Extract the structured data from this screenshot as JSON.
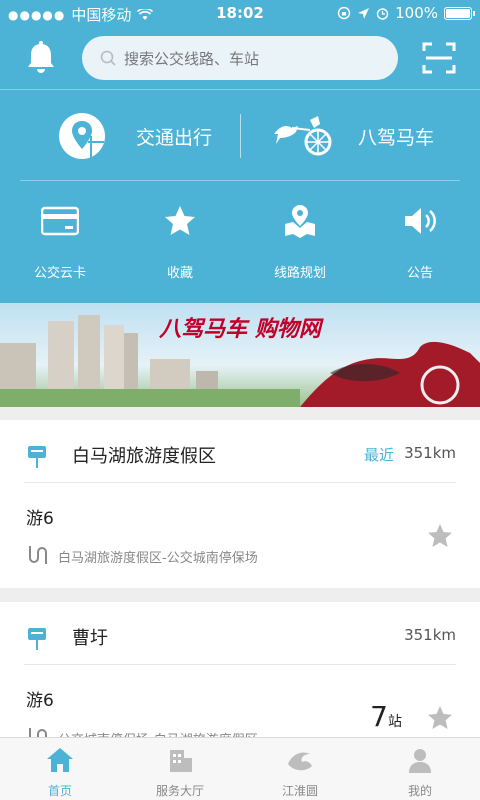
{
  "status": {
    "carrier": "中国移动",
    "time": "18:02",
    "battery": "100%"
  },
  "search": {
    "placeholder": "搜索公交线路、车站"
  },
  "features": [
    {
      "label": "交通出行",
      "icon": "map-pin-icon"
    },
    {
      "label": "八驾马车",
      "icon": "chariot-icon"
    }
  ],
  "quick": [
    {
      "label": "公交云卡",
      "icon": "card-icon"
    },
    {
      "label": "收藏",
      "icon": "star-icon"
    },
    {
      "label": "线路规划",
      "icon": "route-map-icon"
    },
    {
      "label": "公告",
      "icon": "speaker-icon"
    }
  ],
  "banner": {
    "text": "八驾马车 购物网"
  },
  "stations": [
    {
      "name": "白马湖旅游度假区",
      "recent": "最近",
      "distance": "351km",
      "line": "游6",
      "route": "白马湖旅游度假区-公交城南停保场",
      "stops_count": ""
    },
    {
      "name": "曹圩",
      "recent": "",
      "distance": "351km",
      "line": "游6",
      "route": "公交城南停保场-白马湖旅游度假区",
      "stops_count": "7",
      "stops_unit": "站"
    }
  ],
  "tabs": [
    {
      "label": "首页",
      "icon": "home-icon",
      "active": true
    },
    {
      "label": "服务大厅",
      "icon": "building-icon",
      "active": false
    },
    {
      "label": "江淮圆",
      "icon": "wave-icon",
      "active": false
    },
    {
      "label": "我的",
      "icon": "user-icon",
      "active": false
    }
  ],
  "colors": {
    "accent": "#4db3d6",
    "header": "#4db3d6"
  }
}
